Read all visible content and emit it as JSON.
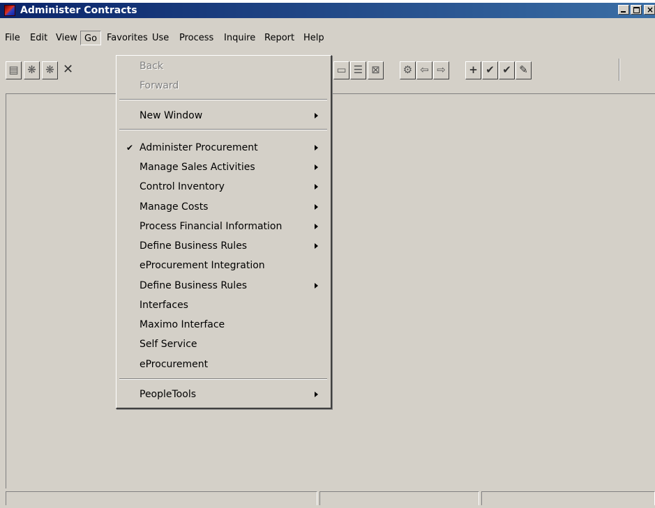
{
  "window": {
    "title": "Administer Contracts"
  },
  "menubar": {
    "items": [
      "File",
      "Edit",
      "View",
      "Go",
      "Favorites",
      "Use",
      "Process",
      "Inquire",
      "Report",
      "Help"
    ],
    "active": "Go"
  },
  "toolbar": {
    "icons": [
      "save-icon",
      "refresh-icon",
      "refresh-all-icon",
      "delete-icon",
      "insert-row-icon",
      "delete-row-icon",
      "worklist-icon",
      "previous-icon",
      "next-icon",
      "add-icon",
      "update-icon",
      "update-all-icon",
      "correction-icon"
    ]
  },
  "go_menu": {
    "back": "Back",
    "forward": "Forward",
    "new_window": "New Window",
    "items": [
      "Administer Procurement",
      "Manage Sales Activities",
      "Control Inventory",
      "Manage Costs",
      "Process Financial Information",
      "Define Business Rules",
      "eProcurement Integration",
      "Define Business Rules",
      "Interfaces",
      "Maximo Interface",
      "Self Service",
      "eProcurement"
    ],
    "checked_item": "Administer Procurement",
    "peopletools": "PeopleTools"
  },
  "colors": {
    "titlebar_start": "#0a246a",
    "titlebar_end": "#3a6ea5",
    "window_bg": "#d4d0c8"
  }
}
